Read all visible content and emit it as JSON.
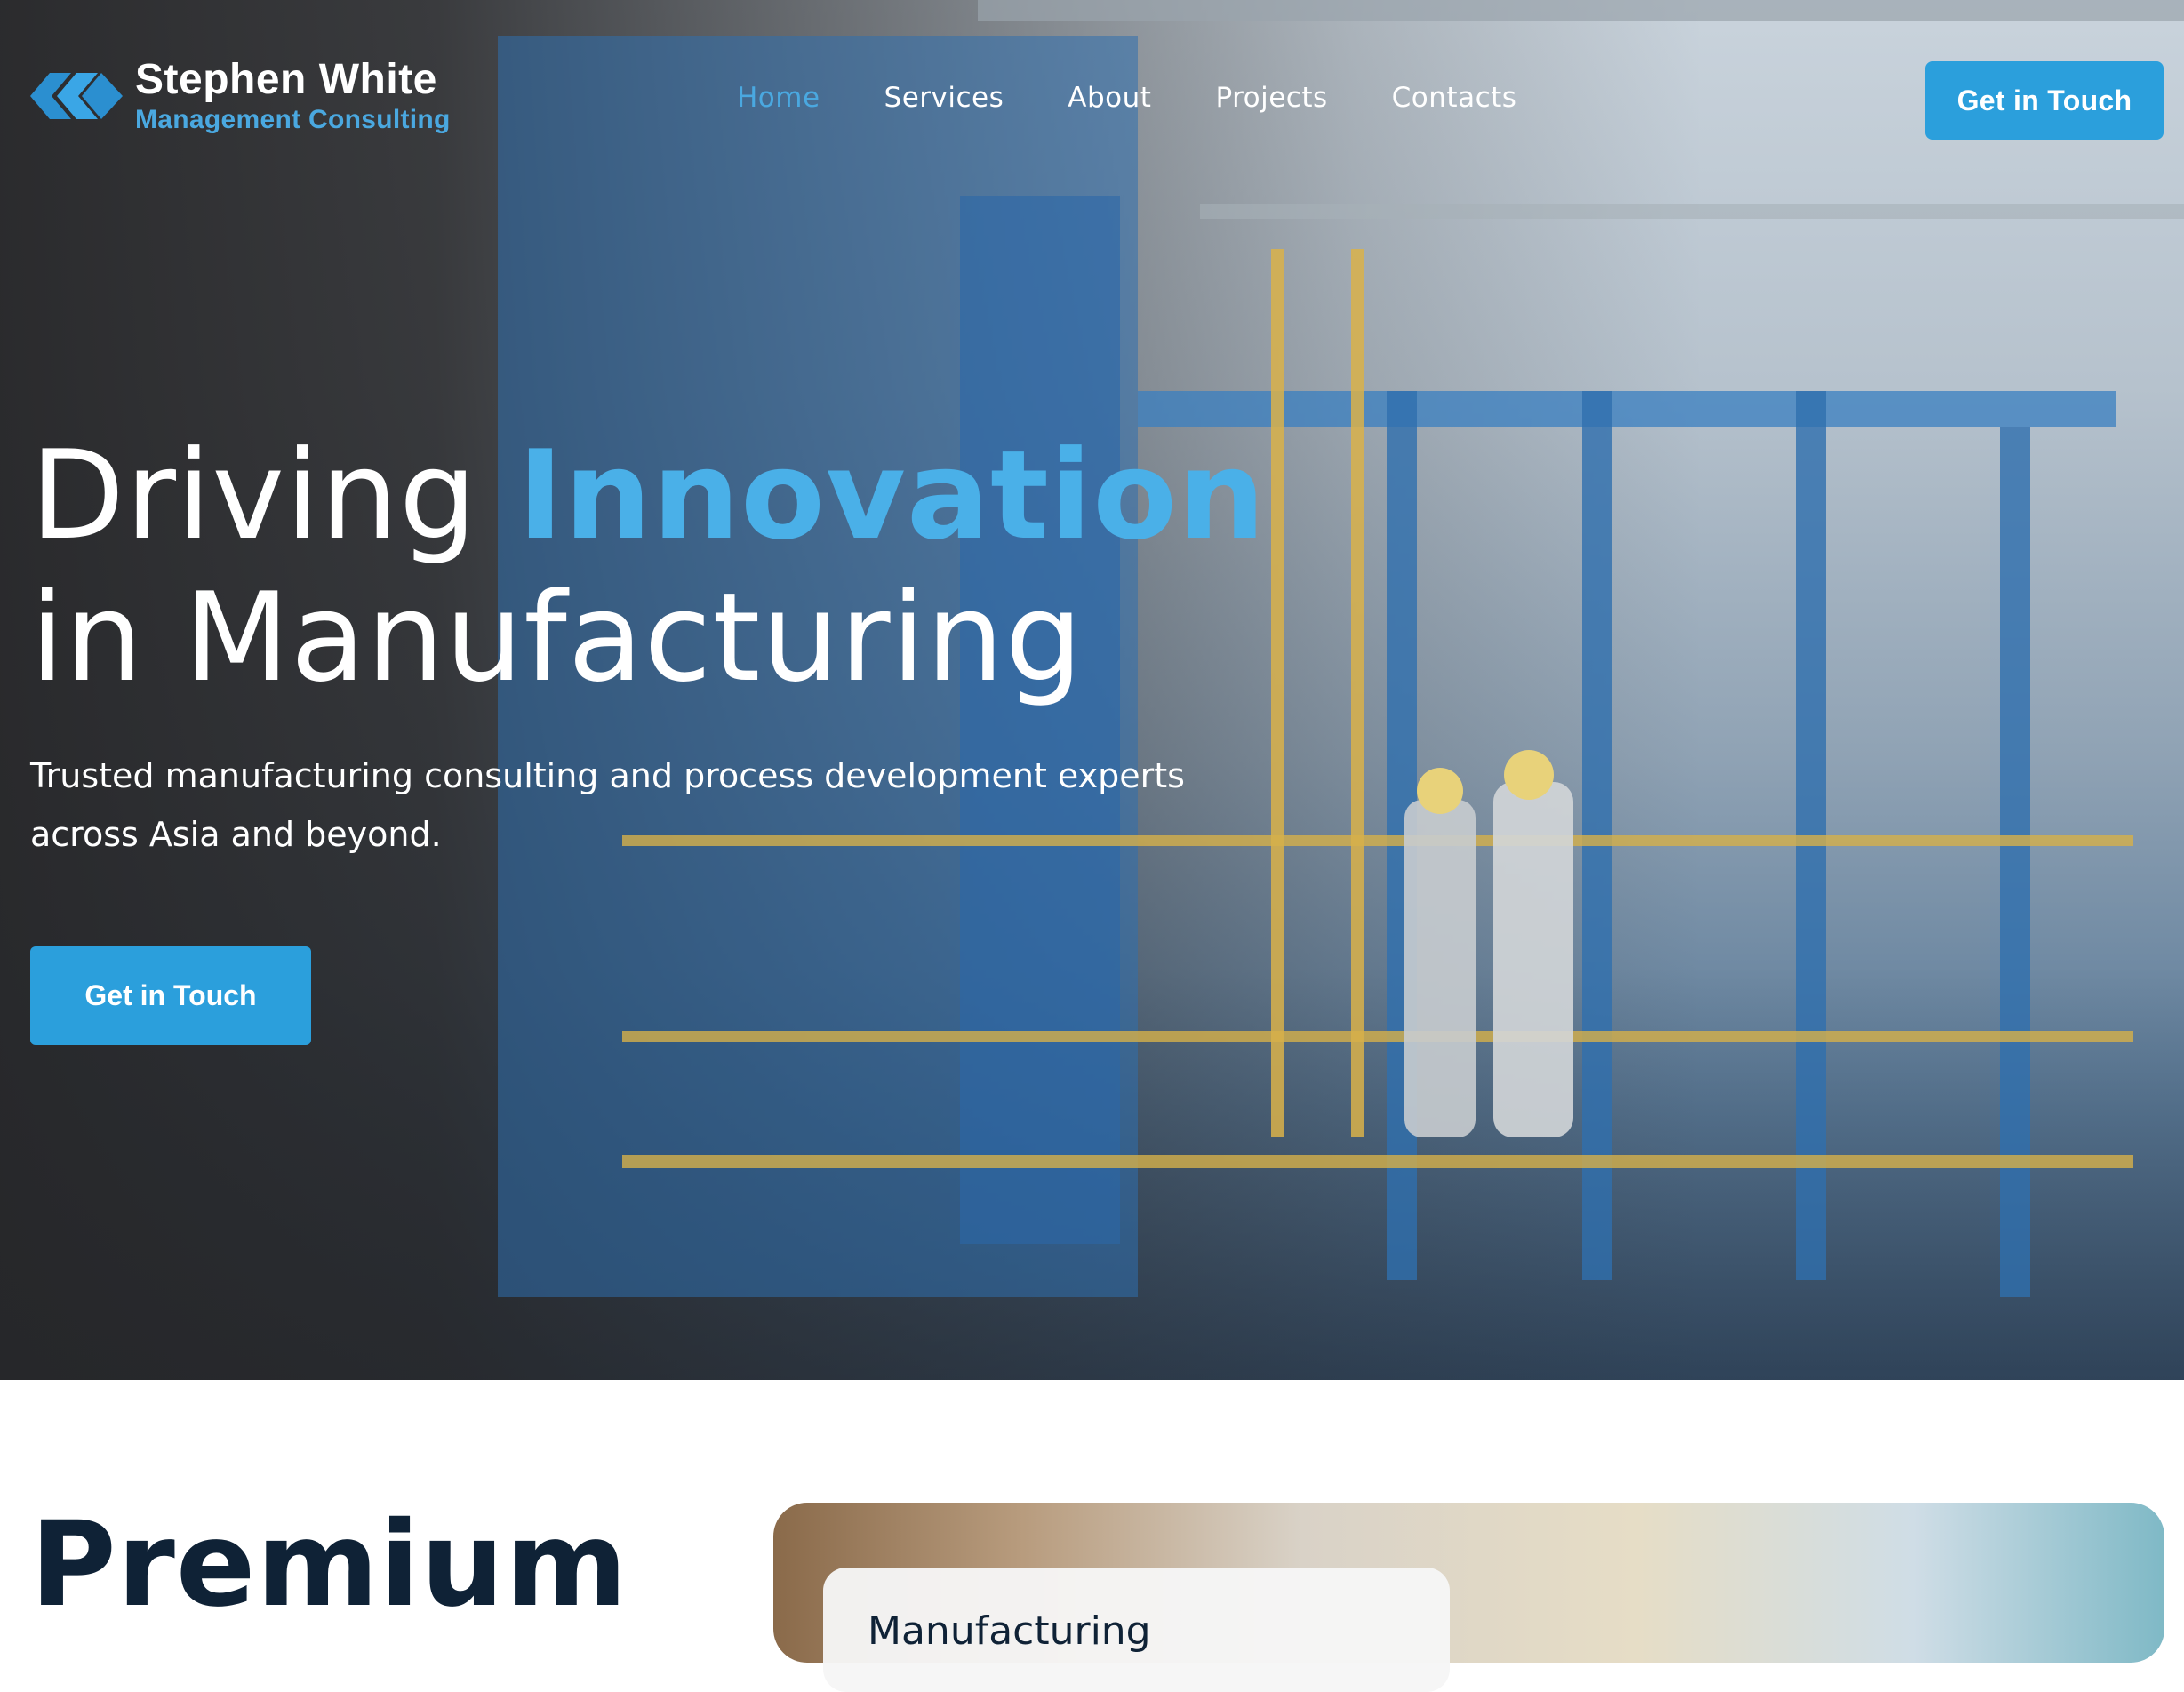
{
  "brand": {
    "name": "Stephen White",
    "tagline": "Management Consulting",
    "logo_icon": "chain-link-logo-icon",
    "accent_color": "#2b9fdc"
  },
  "nav": {
    "items": [
      {
        "label": "Home",
        "active": true
      },
      {
        "label": "Services",
        "active": false
      },
      {
        "label": "About",
        "active": false
      },
      {
        "label": "Projects",
        "active": false
      },
      {
        "label": "Contacts",
        "active": false
      }
    ],
    "cta_label": "Get in Touch"
  },
  "hero": {
    "headline_pre": "Driving ",
    "headline_accent": "Innovation",
    "headline_line2": "in Manufacturing",
    "subtext": "Trusted manufacturing consulting and process development experts across Asia and beyond.",
    "cta_label": "Get in Touch"
  },
  "section": {
    "heading": "Premium",
    "card_label": "Manufacturing"
  }
}
